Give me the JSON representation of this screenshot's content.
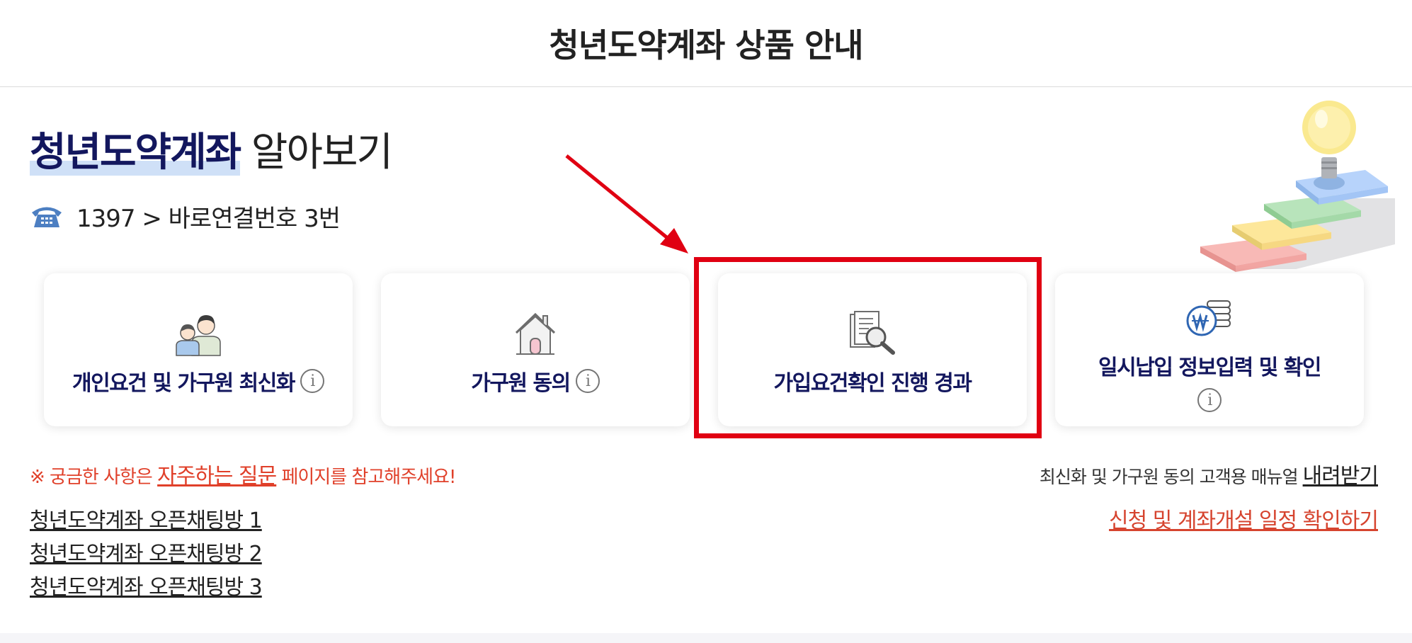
{
  "page_title": "청년도약계좌 상품 안내",
  "intro": {
    "brand": "청년도약계좌",
    "rest": " 알아보기"
  },
  "phone": {
    "icon": "telephone-icon",
    "text": "1397 > 바로연결번호 3번"
  },
  "cards": [
    {
      "label": "개인요건 및 가구원 최신화",
      "icon": "people-icon",
      "has_info": true
    },
    {
      "label": "가구원 동의",
      "icon": "house-icon",
      "has_info": true
    },
    {
      "label": "가입요건확인 진행 경과",
      "icon": "document-search-icon",
      "has_info": false,
      "highlighted": true
    },
    {
      "label": "일시납입 정보입력 및 확인",
      "icon": "won-coins-icon",
      "has_info": true
    }
  ],
  "info_glyph": "i",
  "notice": {
    "prefix": "※ 궁금한 사항은 ",
    "link": "자주하는 질문",
    "suffix": " 페이지를 참고해주세요!"
  },
  "manual": {
    "text": "최신화 및 가구원 동의 고객용 매뉴얼 ",
    "link": "내려받기"
  },
  "chat_links": [
    "청년도약계좌 오픈채팅방 1",
    "청년도약계좌 오픈채팅방 2",
    "청년도약계좌 오픈채팅방 3"
  ],
  "schedule_link": "신청 및 계좌개설 일정 확인하기",
  "colors": {
    "brand_navy": "#13175e",
    "highlight_red": "#e00012",
    "notice_red": "#e0402a",
    "link_red": "#d6442f"
  }
}
